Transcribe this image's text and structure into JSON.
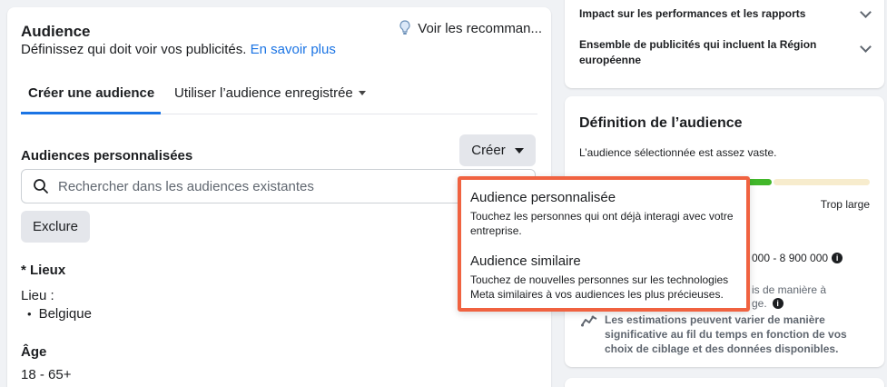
{
  "audience": {
    "title": "Audience",
    "subtitle": "Définissez qui doit voir vos publicités.",
    "learn_more": "En savoir plus",
    "recommendations": "Voir les recomman...",
    "tabs": {
      "create": "Créer une audience",
      "saved": "Utiliser l’audience enregistrée"
    },
    "custom_label": "Audiences personnalisées",
    "create_button": "Créer",
    "search_placeholder": "Rechercher dans les audiences existantes",
    "exclude_button": "Exclure",
    "locations_label": "* Lieux",
    "location_field": "Lieu :",
    "location_value": "Belgique",
    "age_label": "Âge",
    "age_value": "18 - 65+"
  },
  "menu": {
    "items": [
      {
        "title": "Audience personnalisée",
        "desc1": "Touchez les personnes qui ont déjà interagi avec votre",
        "desc2": "entreprise."
      },
      {
        "title": "Audience similaire",
        "desc1": "Touchez de nouvelles personnes sur les technologies",
        "desc2": "Meta similaires à vos audiences les plus précieuses."
      }
    ]
  },
  "right_top": {
    "item1": "Impact sur les performances et les rapports",
    "item2_line1": "Ensemble de publicités qui incluent la Région",
    "item2_line2": "européenne"
  },
  "definition": {
    "title": "Définition de l’audience",
    "subtitle": "L’audience sélectionnée est assez vaste.",
    "broad_label": "Trop large",
    "size_value": "000 - 8 900 000",
    "partial1": "is de manière à",
    "partial2": "ge.",
    "estimates_note": "Les estimations peuvent varier de manière significative au fil du temps en fonction de vos choix de ciblage et des données disponibles.",
    "colors": {
      "meter_green": "#42b72a",
      "meter_pale": "#f7eccd",
      "highlight_border": "#f06240",
      "link": "#1b74e4"
    }
  }
}
